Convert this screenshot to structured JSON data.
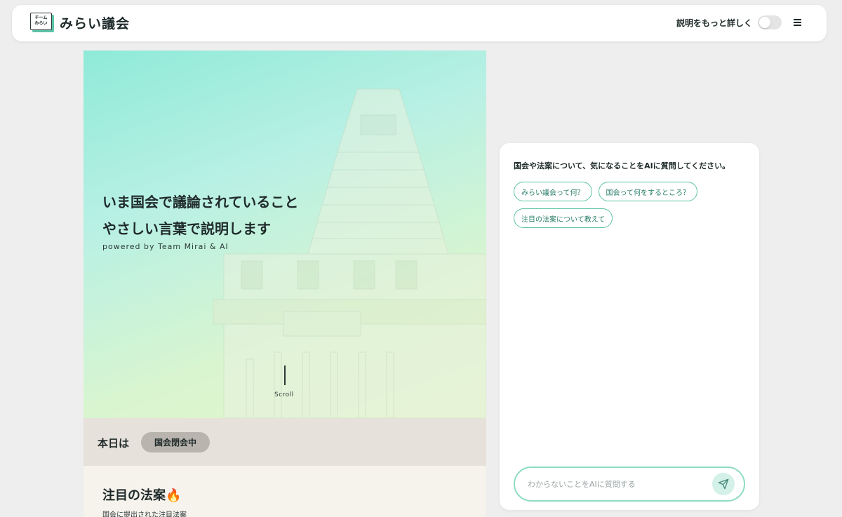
{
  "header": {
    "logo_mark_line1": "チーム",
    "logo_mark_line2": "みらい",
    "logo_text": "みらい議会",
    "toggle_label": "説明をもっと詳しく",
    "toggle_on": false,
    "menu_icon": "hamburger-menu-icon"
  },
  "hero": {
    "title_line1": "いま国会で議論されていること",
    "title_line2": "やさしい言葉で説明します",
    "subtitle": "powered by Team Mirai & AI",
    "scroll_label": "Scroll"
  },
  "today": {
    "label": "本日は",
    "status": "国会閉会中"
  },
  "featured": {
    "title": "注目の法案",
    "title_emoji": "🔥",
    "subtitle": "国会に提出された注目法案"
  },
  "chat": {
    "prompt": "国会や法案について、気になることをAIに質問してください。",
    "suggestions": [
      "みらい議会って何？",
      "国会って何をするところ？",
      "注目の法案について教えて"
    ],
    "input_placeholder": "わからないことをAIに質問する",
    "send_icon": "paper-plane-send-icon"
  },
  "colors": {
    "accent": "#5cc2a6",
    "page_background": "#eeeeee",
    "status_badge": "#b9b4ae"
  }
}
